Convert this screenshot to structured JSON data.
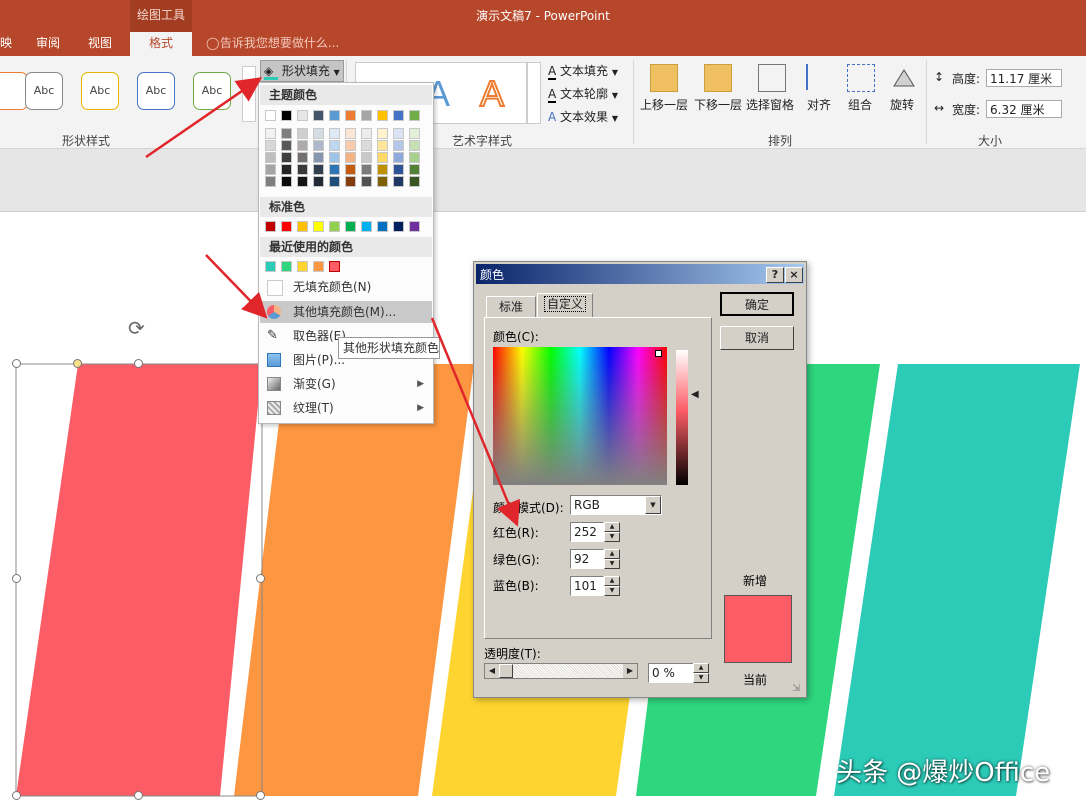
{
  "window": {
    "title": "演示文稿7 - PowerPoint",
    "context_tab_header": "绘图工具"
  },
  "ribbon_tabs": [
    {
      "label": "映"
    },
    {
      "label": "审阅"
    },
    {
      "label": "视图"
    },
    {
      "label": "格式"
    }
  ],
  "tell_me": "告诉我您想要做什么...",
  "shape_styles": {
    "thumbnails": [
      "Abc",
      "Abc",
      "Abc",
      "Abc"
    ],
    "group_label": "形状样式",
    "shape_fill_label": "形状填充"
  },
  "wordart": {
    "text_fill": "文本填充",
    "text_outline": "文本轮廓",
    "text_effects": "文本效果",
    "group_label": "艺术字样式"
  },
  "arrange": {
    "bring_forward": "上移一层",
    "send_backward": "下移一层",
    "selection_pane": "选择窗格",
    "align": "对齐",
    "group": "组合",
    "rotate": "旋转",
    "group_label": "排列"
  },
  "size": {
    "height_label": "高度:",
    "height_value": "11.17 厘米",
    "width_label": "宽度:",
    "width_value": "6.32 厘米",
    "group_label": "大小"
  },
  "fill_menu": {
    "theme_colors_header": "主题颜色",
    "theme_top_row": [
      "#ffffff",
      "#000000",
      "#e7e6e6",
      "#44546a",
      "#5b9bd5",
      "#ed7d31",
      "#a5a5a5",
      "#ffc000",
      "#4472c4",
      "#70ad47"
    ],
    "theme_shades": [
      [
        "#f2f2f2",
        "#7f7f7f",
        "#d0cece",
        "#d6dce4",
        "#deebf6",
        "#fbe5d5",
        "#ededed",
        "#fff2cc",
        "#dae3f3",
        "#e2efd9"
      ],
      [
        "#d8d8d8",
        "#595959",
        "#aeaaaa",
        "#adb9ca",
        "#bdd7ee",
        "#f7cbac",
        "#dbdbdb",
        "#fee599",
        "#b4c6e7",
        "#c5e0b3"
      ],
      [
        "#bfbfbf",
        "#3f3f3f",
        "#757070",
        "#8496b0",
        "#9dc3e6",
        "#f4b183",
        "#c9c9c9",
        "#ffd965",
        "#8eaadb",
        "#a8d08d"
      ],
      [
        "#a5a5a5",
        "#262626",
        "#3a3838",
        "#323f4f",
        "#2e75b5",
        "#c55a11",
        "#7b7b7b",
        "#bf9000",
        "#2f5496",
        "#538135"
      ],
      [
        "#7f7f7f",
        "#0c0c0c",
        "#171616",
        "#222a35",
        "#1e4e79",
        "#833c0b",
        "#525252",
        "#7f6000",
        "#1f3864",
        "#375623"
      ]
    ],
    "standard_colors_header": "标准色",
    "standard_colors": [
      "#c00000",
      "#ff0000",
      "#ffc000",
      "#ffff00",
      "#92d050",
      "#00b050",
      "#00b0f0",
      "#0070c0",
      "#002060",
      "#7030a0"
    ],
    "recent_colors_header": "最近使用的颜色",
    "recent_colors": [
      "#2ccbb8",
      "#2ed67e",
      "#fed530",
      "#fd9640",
      "#fc5c65"
    ],
    "no_fill": "无填充颜色(N)",
    "more_colors": "其他填充颜色(M)...",
    "eyedropper": "取色器(E)",
    "picture": "图片(P)...",
    "gradient": "渐变(G)",
    "texture": "纹理(T)"
  },
  "tooltip": "其他形状填充颜色",
  "color_dialog": {
    "title": "颜色",
    "help": "?",
    "close": "×",
    "tab_standard": "标准",
    "tab_custom": "自定义",
    "colors_label": "颜色(C):",
    "color_model_label": "颜色模式(D):",
    "color_model_value": "RGB",
    "red_label": "红色(R):",
    "red_value": "252",
    "green_label": "绿色(G):",
    "green_value": "92",
    "blue_label": "蓝色(B):",
    "blue_value": "101",
    "transparency_label": "透明度(T):",
    "transparency_value": "0 %",
    "ok": "确定",
    "cancel": "取消",
    "new_label": "新增",
    "current_label": "当前",
    "new_color": "#fc5c65"
  },
  "slide_bars": [
    "#fc5c65",
    "#fd9640",
    "#fed530",
    "#2ed67e",
    "#2ccbb8"
  ],
  "watermark": "头条 @爆炒Office"
}
